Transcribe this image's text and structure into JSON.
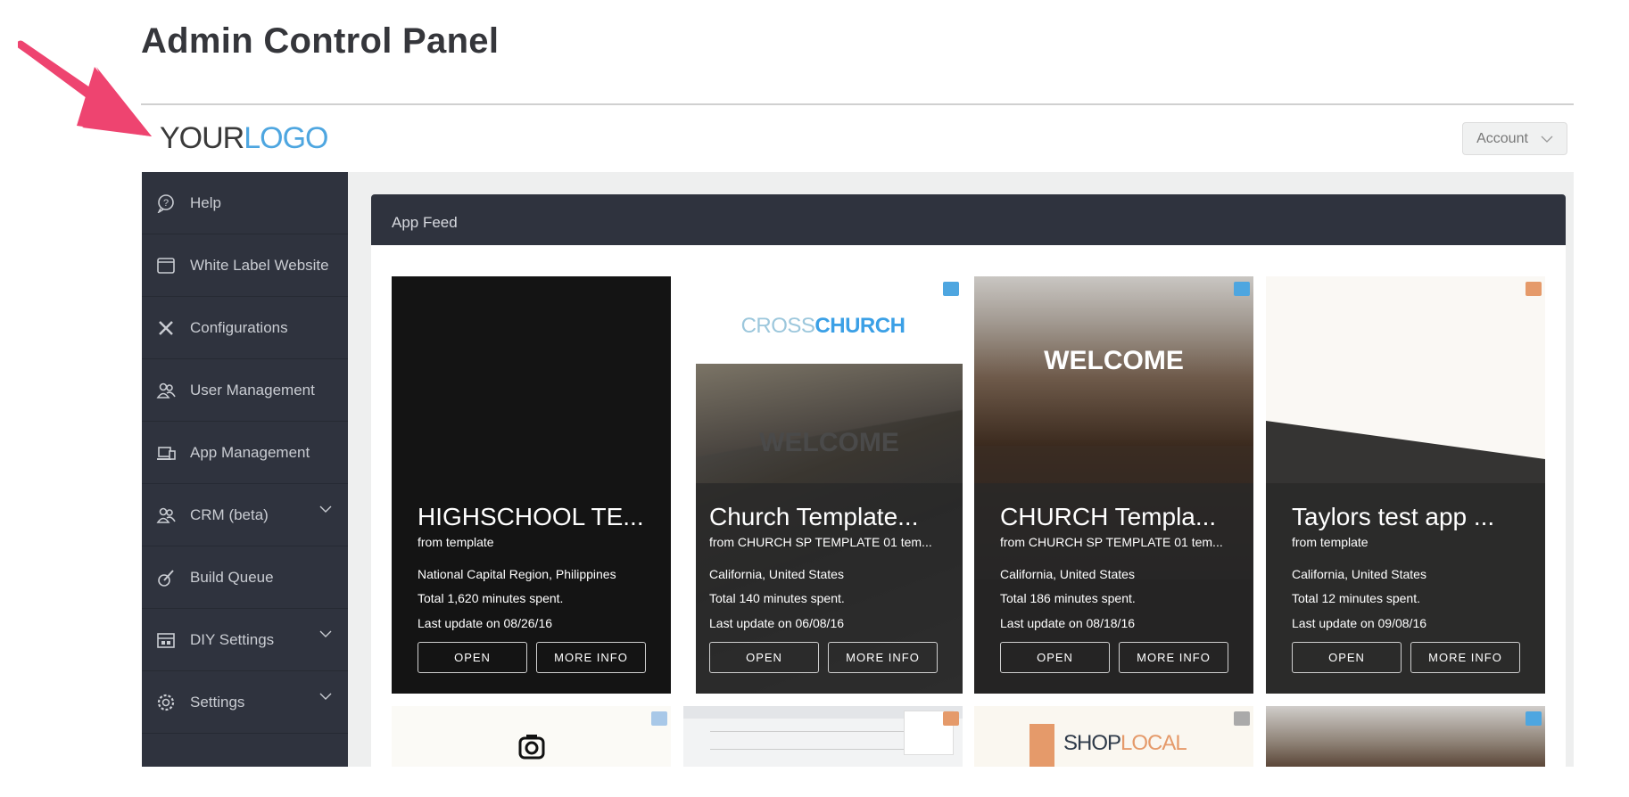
{
  "page_title": "Admin Control Panel",
  "logo": {
    "part1": "YOUR",
    "part2": "LOGO"
  },
  "account_button": "Account",
  "sidebar": {
    "items": [
      {
        "label": "Help",
        "icon": "help-bubble-icon",
        "expandable": false
      },
      {
        "label": "White Label Website",
        "icon": "browser-window-icon",
        "expandable": false
      },
      {
        "label": "Configurations",
        "icon": "tools-icon",
        "expandable": false
      },
      {
        "label": "User Management",
        "icon": "users-icon",
        "expandable": false
      },
      {
        "label": "App Management",
        "icon": "laptop-phone-icon",
        "expandable": false
      },
      {
        "label": "CRM (beta)",
        "icon": "users-icon",
        "expandable": true
      },
      {
        "label": "Build Queue",
        "icon": "build-icon",
        "expandable": false
      },
      {
        "label": "DIY Settings",
        "icon": "store-icon",
        "expandable": true
      },
      {
        "label": "Settings",
        "icon": "gear-icon",
        "expandable": true
      }
    ]
  },
  "feed": {
    "title": "App Feed",
    "open_label": "OPEN",
    "more_label": "MORE INFO",
    "cards": [
      {
        "title": "HIGHSCHOOL TE...",
        "subtitle": "from template",
        "location": "National Capital Region, Philippines",
        "total": "Total 1,620 minutes spent.",
        "updated": "Last update on 08/26/16"
      },
      {
        "title": "Church Template...",
        "subtitle": "from CHURCH SP TEMPLATE 01 tem...",
        "location": "California, United States",
        "total": "Total 140 minutes spent.",
        "updated": "Last update on 06/08/16",
        "brand1": "CROSS",
        "brand2": "CHURCH",
        "overlay": "WELCOME"
      },
      {
        "title": "CHURCH Templa...",
        "subtitle": "from CHURCH SP TEMPLATE 01 tem...",
        "location": "California, United States",
        "total": "Total 186 minutes spent.",
        "updated": "Last update on 08/18/16",
        "overlay": "WELCOME"
      },
      {
        "title": "Taylors test app ...",
        "subtitle": "from template",
        "location": "California, United States",
        "total": "Total 12 minutes spent.",
        "updated": "Last update on 09/08/16"
      }
    ],
    "row2": {
      "shop1": "SHOP",
      "shop2": "LOCAL"
    }
  },
  "colors": {
    "accent": "#3ba0e6",
    "sidebar": "#2f333e",
    "arrow": "#ee4470"
  }
}
